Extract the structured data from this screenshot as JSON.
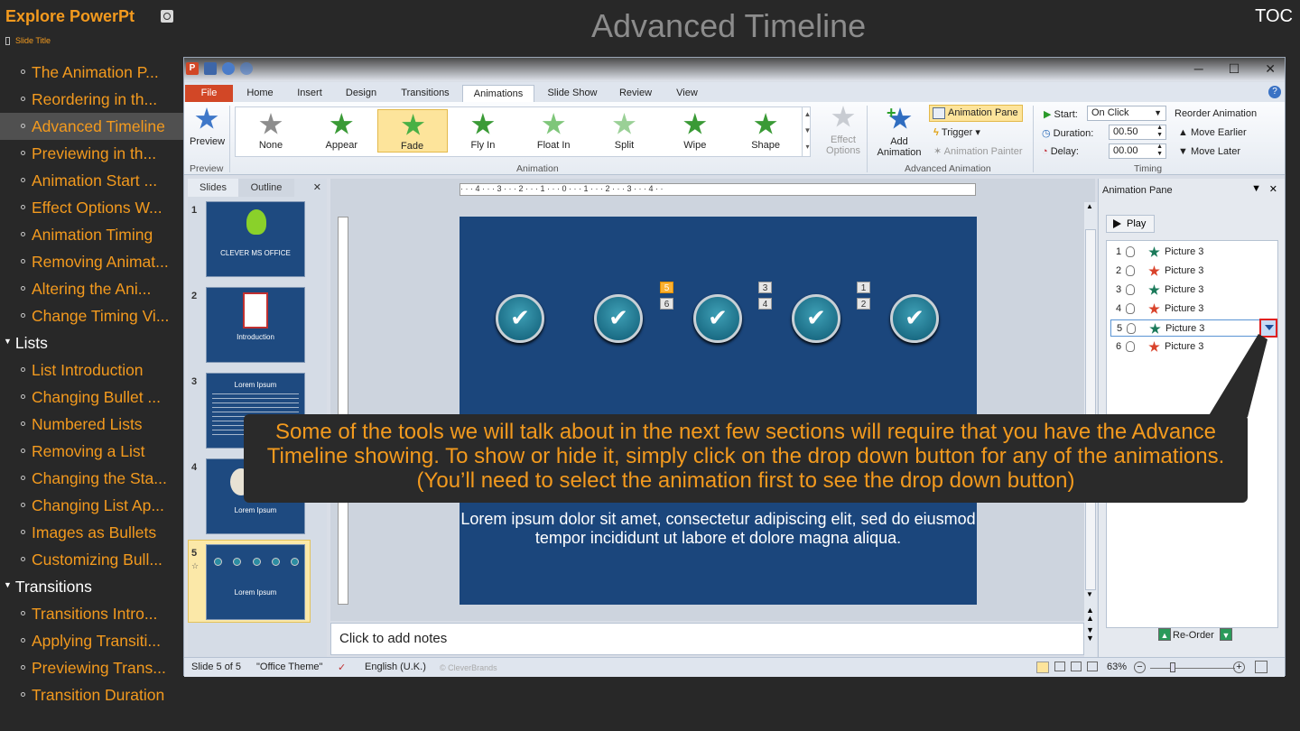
{
  "header": {
    "app_title": "Explore PowerPt",
    "slide_label": "Slide Title",
    "page_title": "Advanced Timeline",
    "toc": "TOC"
  },
  "sidebar": {
    "items": [
      {
        "label": "The Animation P...",
        "active": false
      },
      {
        "label": "Reordering in th...",
        "active": false
      },
      {
        "label": "Advanced Timeline",
        "active": true
      },
      {
        "label": "Previewing in th...",
        "active": false
      },
      {
        "label": "Animation Start ...",
        "active": false
      },
      {
        "label": "Effect Options W...",
        "active": false
      },
      {
        "label": "Animation Timing",
        "active": false
      },
      {
        "label": "Removing Animat...",
        "active": false
      },
      {
        "label": "Altering the Ani...",
        "active": false
      },
      {
        "label": "Change Timing Vi...",
        "active": false
      }
    ],
    "lists_section": "Lists",
    "lists_items": [
      "List Introduction",
      "Changing Bullet ...",
      "Numbered Lists",
      "Removing a List",
      "Changing the Sta...",
      "Changing List Ap...",
      "Images as Bullets",
      "Customizing Bull..."
    ],
    "transitions_section": "Transitions",
    "transitions_items": [
      "Transitions Intro...",
      "Applying Transiti...",
      "Previewing Trans...",
      "Transition Duration"
    ]
  },
  "ppt": {
    "tabs": [
      "File",
      "Home",
      "Insert",
      "Design",
      "Transitions",
      "Animations",
      "Slide Show",
      "Review",
      "View"
    ],
    "preview_label": "Preview",
    "preview_group": "Preview",
    "effects": [
      {
        "label": "None",
        "color": "#8d8d8d"
      },
      {
        "label": "Appear",
        "color": "#3a9a36"
      },
      {
        "label": "Fade",
        "color": "#49b045"
      },
      {
        "label": "Fly In",
        "color": "#3a9a36"
      },
      {
        "label": "Float In",
        "color": "#7fc67a"
      },
      {
        "label": "Split",
        "color": "#9ad096"
      },
      {
        "label": "Wipe",
        "color": "#3a9a36"
      },
      {
        "label": "Shape",
        "color": "#3a9a36"
      }
    ],
    "selected_effect": "Fade",
    "animation_group": "Animation",
    "effect_options": "Effect Options",
    "add_animation": "Add Animation",
    "animation_pane_btn": "Animation Pane",
    "trigger": "Trigger",
    "animation_painter": "Animation Painter",
    "advanced_group": "Advanced Animation",
    "start_label": "Start:",
    "start_value": "On Click",
    "duration_label": "Duration:",
    "duration_value": "00.50",
    "delay_label": "Delay:",
    "delay_value": "00.00",
    "reorder_title": "Reorder Animation",
    "move_earlier": "Move Earlier",
    "move_later": "Move Later",
    "timing_group": "Timing",
    "pane_tab_slides": "Slides",
    "pane_tab_outline": "Outline",
    "thumbs": [
      {
        "num": "1",
        "text": "CLEVER  MS OFFICE"
      },
      {
        "num": "2",
        "text": "Introduction"
      },
      {
        "num": "3",
        "text": "Lorem Ipsum"
      },
      {
        "num": "4",
        "text": "Lorem Ipsum"
      },
      {
        "num": "5",
        "text": "Lorem Ipsum"
      }
    ],
    "ruler_text": "·  ·  ·  4  ·  ·  ·  3  ·  ·  ·  2  ·  ·  ·  1  ·  ·  ·  0  ·  ·  ·  1  ·  ·  ·  2  ·  ·  ·  3  ·  ·  ·  4  ·  ·",
    "tags": [
      "5",
      "6",
      "3",
      "4",
      "1",
      "2"
    ],
    "slide_text": "Lorem ipsum dolor sit amet, consectetur adipiscing elit, sed do eiusmod tempor incididunt ut labore et dolore magna aliqua.",
    "notes_placeholder": "Click to add notes",
    "anim_pane_title": "Animation Pane",
    "play": "Play",
    "anim_items": [
      {
        "num": "1",
        "label": "Picture 3",
        "color": "#1b7a5a"
      },
      {
        "num": "2",
        "label": "Picture 3",
        "color": "#d9432b"
      },
      {
        "num": "3",
        "label": "Picture 3",
        "color": "#1b7a5a"
      },
      {
        "num": "4",
        "label": "Picture 3",
        "color": "#d9432b"
      },
      {
        "num": "5",
        "label": "Picture 3",
        "color": "#1b7a5a"
      },
      {
        "num": "6",
        "label": "Picture 3",
        "color": "#d9432b"
      }
    ],
    "reorder_label": "Re-Order",
    "status": {
      "slide": "Slide 5 of 5",
      "theme": "\"Office Theme\"",
      "language": "English (U.K.)",
      "brand": "© CleverBrands",
      "zoom": "63%"
    }
  },
  "callout": "Some of the tools we will talk about in the next few sections will require that you have the Advance Timeline showing. To show or hide it, simply click on the drop down button for any of the animations. (You’ll need to select the animation first to see the drop down button)"
}
